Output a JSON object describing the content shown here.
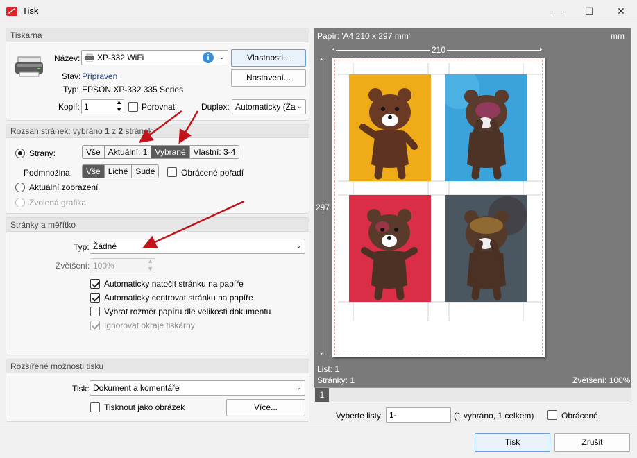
{
  "window": {
    "title": "Tisk",
    "minimize": "—",
    "maximize": "☐",
    "close": "✕"
  },
  "printer": {
    "section_title": "Tiskárna",
    "name_label": "Název:",
    "name_value": "XP-332 WiFi",
    "properties_button": "Vlastnosti...",
    "settings_button": "Nastavení...",
    "status_label": "Stav:",
    "status_value": "Připraven",
    "type_label": "Typ:",
    "type_value": "EPSON XP-332 335 Series",
    "copies_label": "Kopií:",
    "copies_value": "1",
    "collate_label": "Porovnat",
    "duplex_label": "Duplex:",
    "duplex_value": "Automaticky (Ža"
  },
  "range": {
    "section_title_a": "Rozsah stránek: vybráno ",
    "selected": "1",
    "section_title_b": " z ",
    "total": "2",
    "section_title_c": " stránek",
    "pages_label": "Strany:",
    "pages_options": [
      "Vše",
      "Aktuální: 1",
      "Vybrané",
      "Vlastní: 3-4"
    ],
    "subset_label": "Podmnožina:",
    "subset_options": [
      "Vše",
      "Liché",
      "Sudé"
    ],
    "reverse_label": "Obrácené pořadí",
    "current_view_label": "Aktuální zobrazení",
    "selected_graphic_label": "Zvolená grafika"
  },
  "scale": {
    "section_title": "Stránky a měřítko",
    "type_label": "Typ:",
    "type_value": "Žádné",
    "zoom_label": "Zvětšení:",
    "zoom_value": "100%",
    "auto_rotate": "Automaticky natočit stránku na papíře",
    "auto_center": "Automaticky centrovat stránku na papíře",
    "choose_paper": "Vybrat rozměr papíru dle velikosti dokumentu",
    "ignore_margins": "Ignorovat okraje tiskárny"
  },
  "advanced": {
    "section_title": "Rozšířené možnosti tisku",
    "print_label": "Tisk:",
    "print_value": "Dokument a komentáře",
    "as_image_label": "Tisknout jako obrázek",
    "more_button": "Více..."
  },
  "preview": {
    "paper_label": "Papír: 'A4 210 x 297 mm'",
    "unit": "mm",
    "width_dim": "210",
    "height_dim": "297",
    "sheet_info": "List: 1",
    "pages_info": "Stránky: 1",
    "zoom_info": "Zvětšení: 100%",
    "page_tab": "1"
  },
  "sheets": {
    "label": "Vyberte listy:",
    "value": "1-",
    "info": "(1 vybráno, 1 celkem)",
    "reversed_label": "Obrácené"
  },
  "footer": {
    "print_button": "Tisk",
    "cancel_button": "Zrušit"
  },
  "colors": {
    "accent": "#6aa0d8",
    "arrow": "#c0141a",
    "card1": "#f2b21b",
    "card2": "#3aa3dc",
    "card3": "#e0334a",
    "card4": "#4a5660"
  }
}
